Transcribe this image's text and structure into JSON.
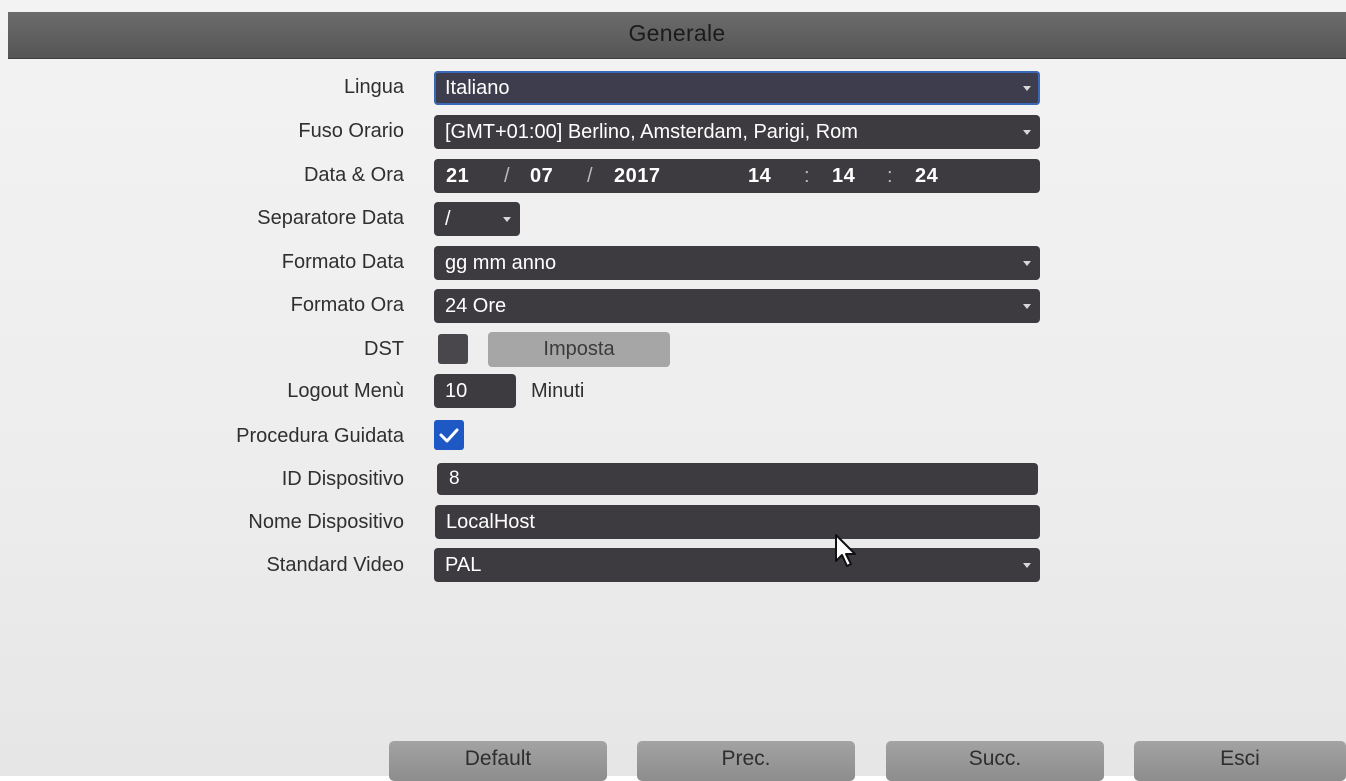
{
  "window": {
    "title": "Generale"
  },
  "settings": {
    "language": {
      "label": "Lingua",
      "value": "Italiano"
    },
    "timezone": {
      "label": "Fuso Orario",
      "value": "[GMT+01:00] Berlino, Amsterdam, Parigi, Rom"
    },
    "datetime": {
      "label": "Data & Ora",
      "day": "21",
      "month": "07",
      "year": "2017",
      "hour": "14",
      "minute": "14",
      "second": "24",
      "date_sep": "/",
      "time_sep": ":"
    },
    "date_separator": {
      "label": "Separatore Data",
      "value": "/"
    },
    "date_format": {
      "label": "Formato Data",
      "value": "gg mm anno"
    },
    "time_format": {
      "label": "Formato Ora",
      "value": "24 Ore"
    },
    "dst": {
      "label": "DST",
      "checked": false,
      "button_label": "Imposta"
    },
    "logout": {
      "label": "Logout Menù",
      "value": "10",
      "unit": "Minuti"
    },
    "wizard": {
      "label": "Procedura Guidata",
      "checked": true
    },
    "device_id": {
      "label": "ID Dispositivo",
      "value": "8"
    },
    "device_name": {
      "label": "Nome Dispositivo",
      "value": "LocalHost"
    },
    "video_standard": {
      "label": "Standard Video",
      "value": "PAL"
    }
  },
  "footer": {
    "default_label": "Default",
    "prev_label": "Prec.",
    "next_label": "Succ.",
    "exit_label": "Esci"
  },
  "colors": {
    "field_bg": "#3d3b40",
    "focus_border": "#3a68b8",
    "checkbox_checked": "#1d58c4",
    "titlebar": "#5f5f5f",
    "button_bg": "#a6a6a6"
  }
}
